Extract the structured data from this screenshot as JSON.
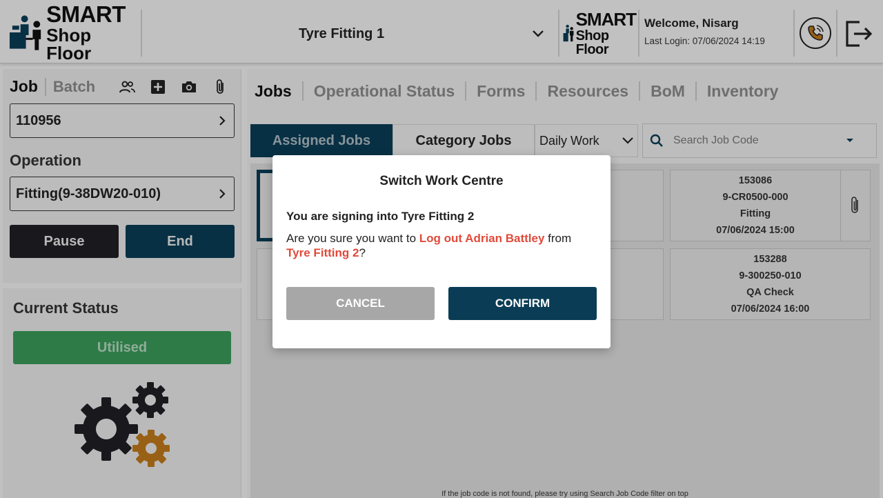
{
  "header": {
    "logo": {
      "line1": "SMART",
      "line2": "Shop Floor"
    },
    "work_centre": "Tyre Fitting 1",
    "logo_small": {
      "line1": "SMART",
      "line2": "Shop Floor"
    },
    "welcome": "Welcome, Nisarg",
    "last_login": "Last Login: 07/06/2024 14:19",
    "icons": {
      "phone": "phone-icon",
      "logout": "logout-icon",
      "dropdown": "chevron-down-icon"
    }
  },
  "job_panel": {
    "tab_job": "Job",
    "tab_batch": "Batch",
    "icons": [
      "people-icon",
      "add-box-icon",
      "camera-icon",
      "paperclip-icon"
    ],
    "job_value": "110956",
    "operation_label": "Operation",
    "operation_value": "Fitting(9-38DW20-010)",
    "pause_label": "Pause",
    "end_label": "End"
  },
  "status_panel": {
    "title": "Current Status",
    "status": "Utilised",
    "status_color": "#3a9a5a"
  },
  "main": {
    "tabs": [
      {
        "label": "Jobs",
        "active": true
      },
      {
        "label": "Operational Status",
        "active": false
      },
      {
        "label": "Forms",
        "active": false
      },
      {
        "label": "Resources",
        "active": false
      },
      {
        "label": "BoM",
        "active": false
      },
      {
        "label": "Inventory",
        "active": false
      }
    ],
    "subtabs": {
      "assigned": "Assigned Jobs",
      "category": "Category Jobs"
    },
    "filter": "Daily Work",
    "search_placeholder": "Search Job Code",
    "cards": [
      {
        "job": "153086",
        "part": "9-CR0500-000",
        "operation": "Fitting",
        "date": "07/06/2024 15:00"
      },
      {
        "job": "153288",
        "part": "9-300250-010",
        "operation": "QA Check",
        "date": "07/06/2024 16:00"
      }
    ],
    "hint": "If the job code is not found, please try using Search Job Code filter on top"
  },
  "modal": {
    "title": "Switch Work Centre",
    "line1": "You are signing into Tyre Fitting 2",
    "line2_prefix": "Are you sure you want to ",
    "line2_red1": "Log out Adrian Battley",
    "line2_mid": " from ",
    "line2_red2": "Tyre Fitting 2",
    "line2_suffix": "?",
    "cancel_label": "CANCEL",
    "confirm_label": "CONFIRM"
  },
  "colors": {
    "primary": "#0a3d55",
    "dark": "#1f1f25",
    "danger_text": "#e04a3a",
    "gear_accent": "#c07a1c"
  }
}
